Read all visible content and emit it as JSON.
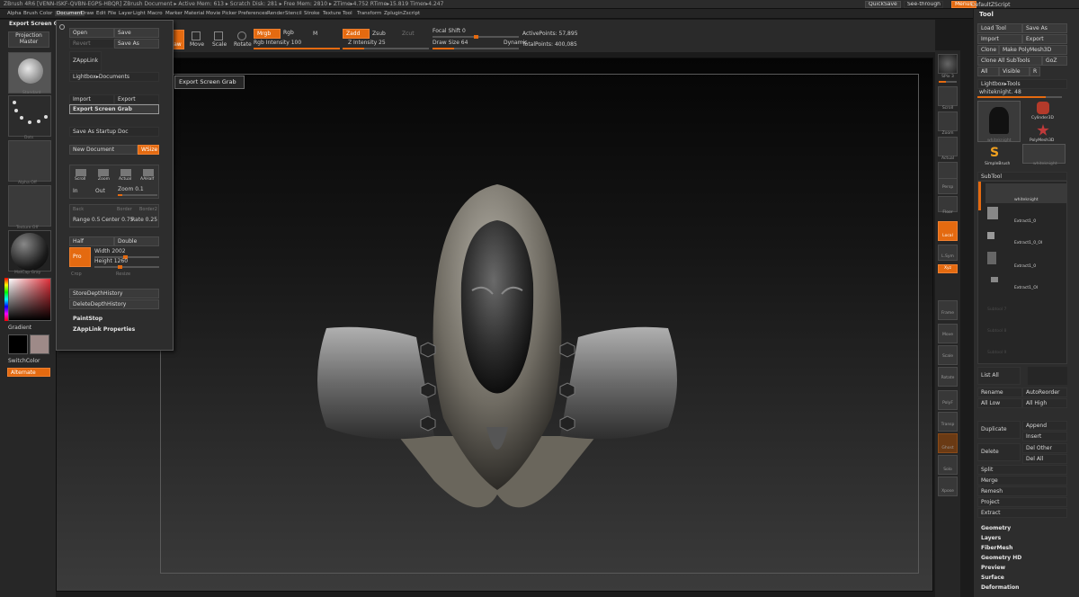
{
  "window": {
    "title": "ZBrush 4R6 [VENN-ISKF-QVBN-EGPS-HBQR]   ZBrush Document    ▸ Active Mem: 613  ▸ Scratch Disk: 281  ▸ Free Mem: 2810  ▸ ZTime▸4.752  RTime▸15.819  Timer▸4.247",
    "quicksave": "QuickSave",
    "seethrough": "See-through  0",
    "menus_btn": "Menus",
    "zscript": "DefaultZScript"
  },
  "menubar": [
    "Alpha",
    "Brush",
    "Color",
    "Document",
    "Draw",
    "Edit",
    "File",
    "Layer",
    "Light",
    "Macro",
    "Marker",
    "Material",
    "Movie",
    "Picker",
    "Preferences",
    "Render",
    "Stencil",
    "Stroke",
    "Texture",
    "Tool",
    "Transform",
    "Zplugin",
    "Zscript"
  ],
  "left_shelf": {
    "header": "Export Screen Grab",
    "projection_master": "Projection\nMaster",
    "lightbox": "LightB",
    "thumb_labels": [
      "Standard",
      "Dots",
      "Alpha Off",
      "Texture Off",
      "MatCap Gray"
    ],
    "gradient": "Gradient",
    "switchcolor": "SwitchColor",
    "alternate": "Alternate",
    "colors": {
      "main": "#000000",
      "secondary": "#9e8a88"
    }
  },
  "toolbar": {
    "buttons": [
      "Draw",
      "Move",
      "Scale",
      "Rotate"
    ],
    "mrgb": "Mrgb",
    "rgb": "Rgb",
    "m": "M",
    "zadd": "Zadd",
    "zsub": "Zsub",
    "zcut": "Zcut",
    "rgb_intensity": "Rgb Intensity 100",
    "z_intensity": "Z Intensity 25",
    "focal_shift": "Focal Shift 0",
    "draw_size": "Draw Size 64",
    "dynamic": "Dynamic",
    "active_points": "ActivePoints: 57,895",
    "total_points": "TotalPoints: 400,085"
  },
  "document_menu": {
    "open": "Open",
    "save": "Save",
    "revert": "Revert",
    "save_as": "Save As",
    "zapplink": "ZAppLink",
    "lightbox_docs": "Lightbox▸Documents",
    "import": "Import",
    "export": "Export",
    "export_screen_grab": "Export Screen Grab",
    "save_as_startup": "Save As Startup Doc",
    "new_document": "New Document",
    "wsize": "WSize",
    "nav_icons": [
      "Scroll",
      "Zoom",
      "Actual",
      "AAHalf"
    ],
    "in": "In",
    "out": "Out",
    "zoom": "Zoom 0.1",
    "back": "Back",
    "border": "Border",
    "border2": "Border2",
    "range": "Range 0.5",
    "center": "Center 0.75",
    "rate": "Rate 0.25",
    "half": "Half",
    "double": "Double",
    "pro": "Pro",
    "width": "Width 2002",
    "height": "Height 1260",
    "crop": "Crop",
    "resize": "Resize",
    "store_depth": "StoreDepthHistory",
    "delete_depth": "DeleteDepthHistory",
    "paintstop": "PaintStop",
    "zapplink_props": "ZAppLink Properties"
  },
  "tooltip": "Export Screen Grab",
  "right_shelf": {
    "spix": "SPix 3",
    "icons": [
      "Scroll",
      "Zoom",
      "Actual",
      "AAHalf",
      "Persp",
      "Floor",
      "Local",
      "L.Sym",
      "Xyz",
      "Frame",
      "Move",
      "Scale",
      "Rotate",
      "PolyF",
      "Transp",
      "Ghost",
      "Solo",
      "Xpose"
    ]
  },
  "tool_panel": {
    "title": "Tool",
    "load_tool": "Load Tool",
    "save_as": "Save As",
    "import": "Import",
    "export": "Export",
    "clone": "Clone",
    "make_polymesh": "Make PolyMesh3D",
    "clone_all": "Clone  All SubTools",
    "goz": "GoZ",
    "all": "All",
    "visible": "Visible",
    "r": "R",
    "lightbox_tools": "Lightbox▸Tools",
    "current_tool": "whiteknight. 48",
    "tool_thumbs": [
      "whiteknight",
      "Cylinder3D",
      "PolyMesh3D",
      "SimpleBrush",
      "whiteknight"
    ],
    "subtool_header": "SubTool",
    "subtools": [
      "whiteknight",
      "Extract1_0",
      "Extract1_0_OI",
      "Extract1_0",
      "Extract1_OI"
    ],
    "subtool_empty": [
      "Subtool 7",
      "Subtool 8",
      "Subtool 9"
    ],
    "list_all": "List  All",
    "rename": "Rename",
    "autoreorder": "AutoReorder",
    "all_low": "All Low",
    "all_high": "All High",
    "duplicate": "Duplicate",
    "append": "Append",
    "insert": "Insert",
    "delete": "Delete",
    "del_other": "Del Other",
    "del_all": "Del All",
    "split": "Split",
    "merge": "Merge",
    "remesh": "Remesh",
    "project": "Project",
    "extract": "Extract",
    "sections": [
      "Geometry",
      "Layers",
      "FiberMesh",
      "Geometry HD",
      "Preview",
      "Surface",
      "Deformation"
    ]
  }
}
